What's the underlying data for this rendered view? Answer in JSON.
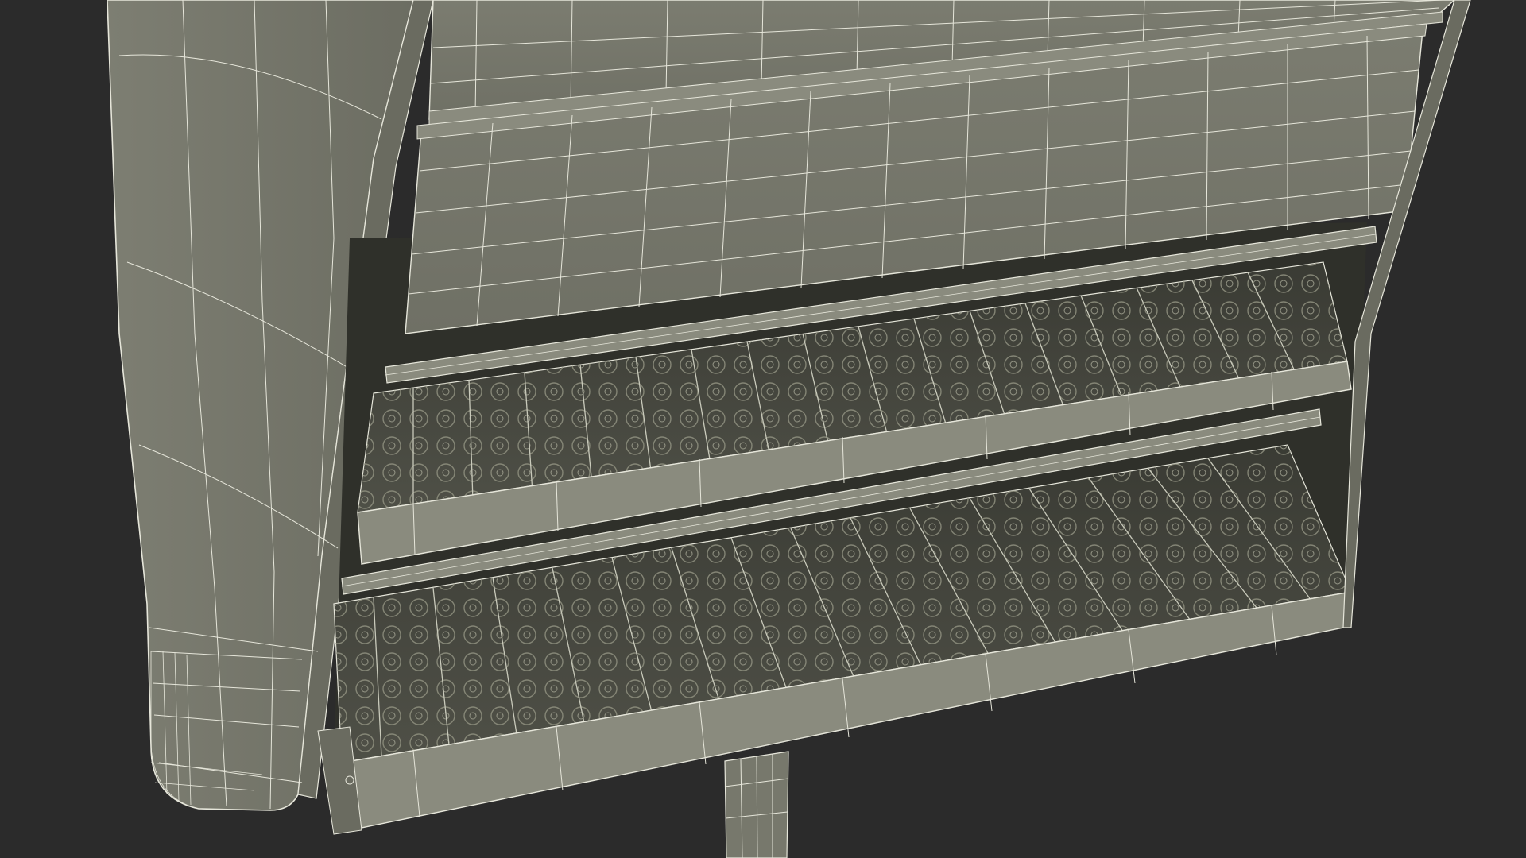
{
  "scene": {
    "subject": "supermarket-shelf-wireframe",
    "colors": {
      "background": "#2b2b2b",
      "surface": "#77786c",
      "surface_light": "#8a8b7e",
      "surface_dark": "#3c3d36",
      "tray_floor": "#46473f",
      "wire": "#e6e6da",
      "edge": "#2f302a"
    }
  }
}
